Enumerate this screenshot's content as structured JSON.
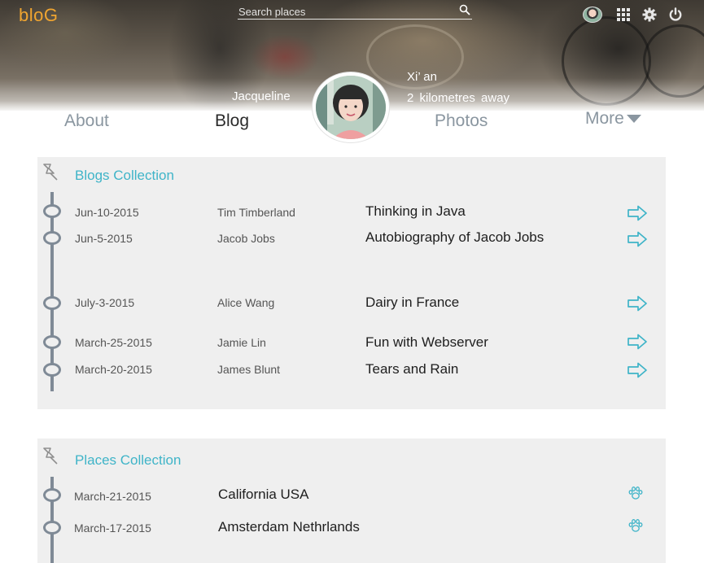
{
  "brand": {
    "logo_text": "bloG",
    "logo_color": "#f0a530"
  },
  "search": {
    "placeholder": "Search places",
    "value": ""
  },
  "header_icons": [
    "avatar",
    "grid-icon",
    "gear-icon",
    "power-icon"
  ],
  "profile": {
    "name": "Jacqueline",
    "city": "Xi’  an",
    "distance": "2 kilometres away"
  },
  "nav": {
    "items": [
      {
        "label": "About",
        "active": false
      },
      {
        "label": "Blog",
        "active": true
      },
      {
        "label": "Photos",
        "active": false
      },
      {
        "label": "More",
        "active": false
      }
    ]
  },
  "blogs": {
    "title": "Blogs Collection",
    "accent_color": "#3fb4c8",
    "items": [
      {
        "date": "Jun-10-2015",
        "author": "Tim Timberland",
        "title": "Thinking in Java"
      },
      {
        "date": "Jun-5-2015",
        "author": "Jacob Jobs",
        "title": "Autobiography of Jacob Jobs"
      },
      {
        "date": "July-3-2015",
        "author": "Alice Wang",
        "title": "Dairy in France"
      },
      {
        "date": "March-25-2015",
        "author": "Jamie Lin",
        "title": "Fun with Webserver"
      },
      {
        "date": "March-20-2015",
        "author": "James Blunt",
        "title": "Tears and Rain"
      }
    ]
  },
  "places": {
    "title": "Places Collection",
    "items": [
      {
        "date": "March-21-2015",
        "name": "California USA"
      },
      {
        "date": "March-17-2015",
        "name": "Amsterdam Nethrlands"
      }
    ]
  }
}
